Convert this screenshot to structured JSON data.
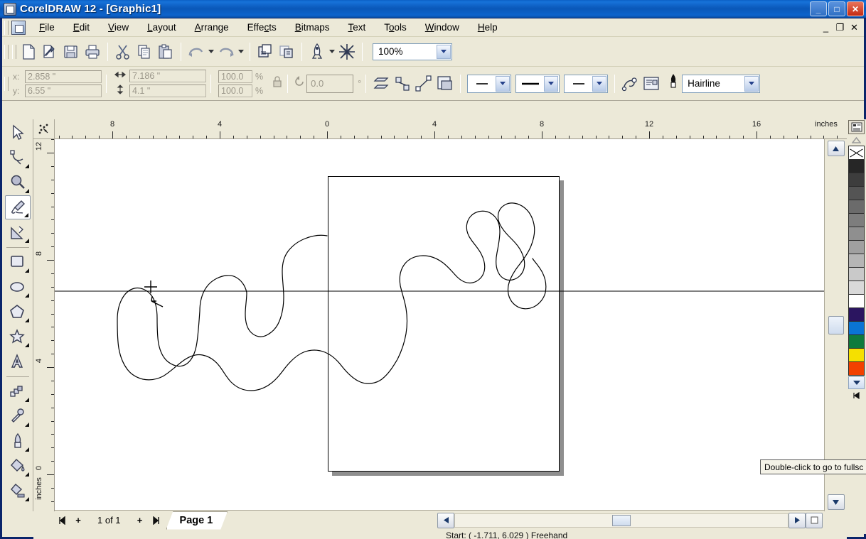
{
  "window": {
    "title": "CorelDRAW 12 - [Graphic1]",
    "minimize": "_",
    "maximize": "□",
    "close": "✕",
    "mdi_minimize": "_",
    "mdi_restore": "❐",
    "mdi_close": "✕"
  },
  "menu": {
    "items": [
      {
        "label": "File",
        "accel": "F"
      },
      {
        "label": "Edit",
        "accel": "E"
      },
      {
        "label": "View",
        "accel": "V"
      },
      {
        "label": "Layout",
        "accel": "L"
      },
      {
        "label": "Arrange",
        "accel": "A"
      },
      {
        "label": "Effects",
        "accel": "c"
      },
      {
        "label": "Bitmaps",
        "accel": "B"
      },
      {
        "label": "Text",
        "accel": "T"
      },
      {
        "label": "Tools",
        "accel": "o"
      },
      {
        "label": "Window",
        "accel": "W"
      },
      {
        "label": "Help",
        "accel": "H"
      }
    ]
  },
  "standard_toolbar": {
    "buttons": [
      "new-icon",
      "open-icon",
      "save-icon",
      "print-icon",
      "cut-icon",
      "copy-icon",
      "paste-icon",
      "undo-icon",
      "redo-icon",
      "import-icon",
      "export-icon",
      "application-launcher-icon",
      "corel-online-icon"
    ],
    "zoom_level": "100%"
  },
  "property_bar": {
    "x_label": "x:",
    "y_label": "y:",
    "x_value": "2.858 \"",
    "y_value": "6.55 \"",
    "width_value": "7.186 \"",
    "height_value": "4.1 \"",
    "scale_h": "100.0",
    "scale_v": "100.0",
    "percent_symbol": "%",
    "lock_ratio": "lock-icon",
    "rotation_value": "0.0",
    "rotation_unit": "°",
    "mirror_h": "mirror-horizontal-icon",
    "mirror_v": "mirror-vertical-icon",
    "to_curves": "convert-to-curves-icon",
    "wrap_text": "wrap-paragraph-text-icon",
    "outline_width": "Hairline",
    "outline_pen": "outline-pen-icon"
  },
  "toolbox": {
    "tools": [
      {
        "name": "pick-tool",
        "selected": false
      },
      {
        "name": "shape-tool",
        "selected": false
      },
      {
        "name": "zoom-tool",
        "selected": false
      },
      {
        "name": "freehand-tool",
        "selected": true
      },
      {
        "name": "smart-drawing-tool",
        "selected": false
      },
      {
        "name": "rectangle-tool",
        "selected": false
      },
      {
        "name": "ellipse-tool",
        "selected": false
      },
      {
        "name": "polygon-tool",
        "selected": false
      },
      {
        "name": "basic-shapes-tool",
        "selected": false
      },
      {
        "name": "text-tool",
        "selected": false
      },
      {
        "name": "interactive-blend-tool",
        "selected": false
      },
      {
        "name": "eyedropper-tool",
        "selected": false
      },
      {
        "name": "outline-tool",
        "selected": false
      },
      {
        "name": "fill-tool",
        "selected": false
      },
      {
        "name": "interactive-fill-tool",
        "selected": false
      }
    ]
  },
  "rulers": {
    "unit": "inches",
    "horizontal_labels": [
      "8",
      "4",
      "0",
      "4",
      "8",
      "12",
      "16"
    ],
    "vertical_labels": [
      "12",
      "8",
      "4",
      "0"
    ]
  },
  "page_navigator": {
    "first": "◀|",
    "add_before": "+",
    "counter": "1 of 1",
    "add_after": "+",
    "last": "|▶",
    "tab_label": "Page 1"
  },
  "status_bar": {
    "text": "Start: ( -1.711, 6.029 ) Freehand"
  },
  "tooltip": {
    "text": "Double-click to go to fullsc"
  },
  "palette": {
    "header_icon": "palette-options-icon",
    "scroll_up": "scroll-up-icon",
    "scroll_down": "scroll-down-icon",
    "palette_end": "palette-end-icon",
    "colors": [
      "none",
      "#262626",
      "#3d3d3d",
      "#545454",
      "#6b6b6b",
      "#7d7d7d",
      "#8f8f8f",
      "#a0a0a0",
      "#b5b5b5",
      "#c9c9c9",
      "#d9d9d9",
      "#ffffff",
      "#2b1560",
      "#0a74d4",
      "#0f7a3c",
      "#f5e000",
      "#f24100"
    ]
  },
  "canvas": {
    "page_border_color": "#000000",
    "shadow_color": "#8f8f8f",
    "drawing_name": "freehand-curve-drawing"
  },
  "scrollbars": {
    "v_up": "▲",
    "v_down": "▼",
    "h_left": "◀",
    "h_right": "▶"
  }
}
